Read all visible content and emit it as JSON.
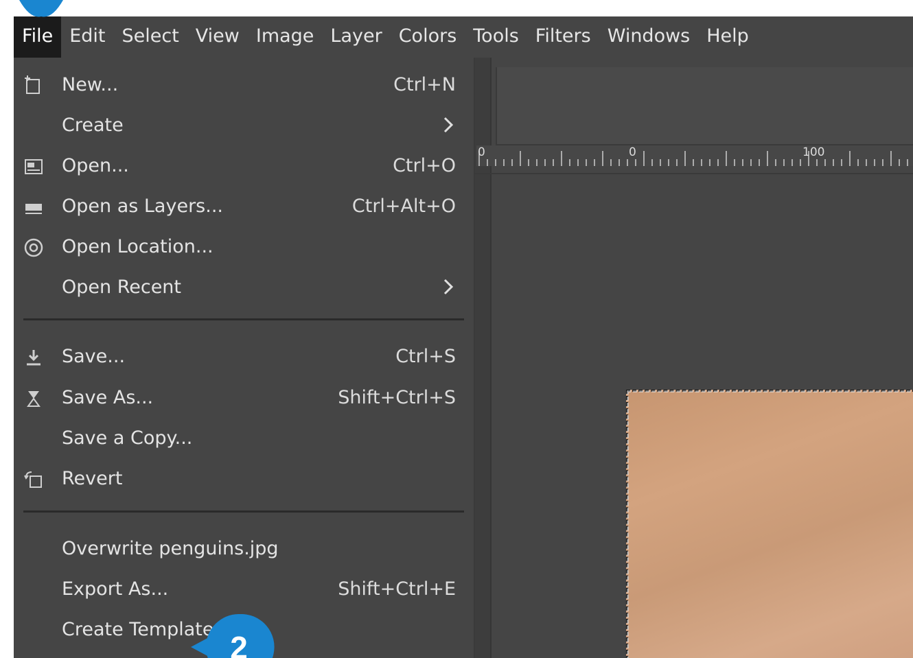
{
  "menubar": {
    "items": [
      "File",
      "Edit",
      "Select",
      "View",
      "Image",
      "Layer",
      "Colors",
      "Tools",
      "Filters",
      "Windows",
      "Help"
    ]
  },
  "file_menu": {
    "items": [
      {
        "label": "New...",
        "shortcut": "Ctrl+N",
        "icon": "new-file-icon"
      },
      {
        "label": "Create",
        "shortcut": "",
        "icon": "",
        "submenu": true
      },
      {
        "label": "Open...",
        "shortcut": "Ctrl+O",
        "icon": "open-image-icon"
      },
      {
        "label": "Open as Layers...",
        "shortcut": "Ctrl+Alt+O",
        "icon": "open-layers-icon"
      },
      {
        "label": "Open Location...",
        "shortcut": "",
        "icon": "globe-icon"
      },
      {
        "label": "Open Recent",
        "shortcut": "",
        "icon": "",
        "submenu": true
      },
      {
        "label": "Save...",
        "shortcut": "Ctrl+S",
        "icon": "save-icon"
      },
      {
        "label": "Save As...",
        "shortcut": "Shift+Ctrl+S",
        "icon": "save-as-icon"
      },
      {
        "label": "Save a Copy...",
        "shortcut": "",
        "icon": ""
      },
      {
        "label": "Revert",
        "shortcut": "",
        "icon": "revert-icon"
      },
      {
        "label": "Overwrite penguins.jpg",
        "shortcut": "",
        "icon": ""
      },
      {
        "label": "Export As...",
        "shortcut": "Shift+Ctrl+E",
        "icon": ""
      },
      {
        "label": "Create Template...",
        "shortcut": "",
        "icon": ""
      }
    ]
  },
  "ruler": {
    "labels": [
      "0",
      "0",
      "100"
    ]
  },
  "callout": {
    "number": "2",
    "color": "#1a86d0"
  },
  "colors": {
    "ui_background": "#454545",
    "active_menu": "#1b1b1b",
    "callout": "#1a86d0"
  }
}
